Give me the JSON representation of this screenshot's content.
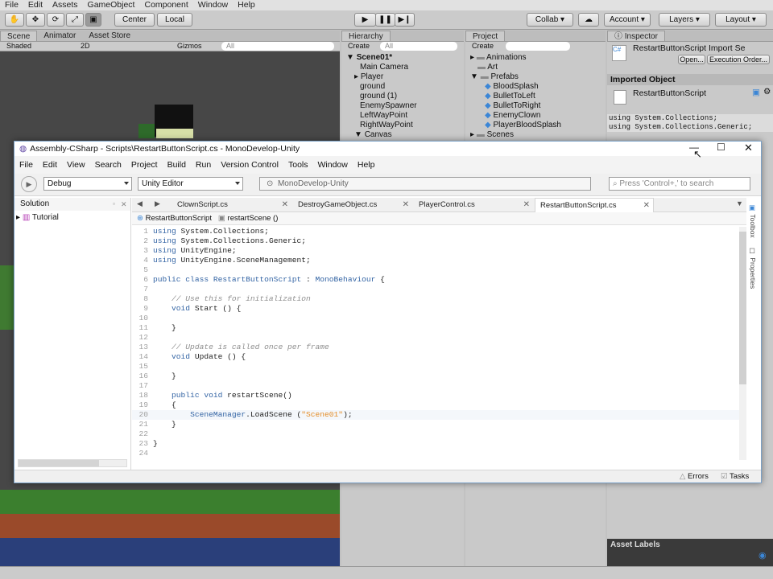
{
  "unity": {
    "menu": [
      "File",
      "Edit",
      "Assets",
      "GameObject",
      "Component",
      "Window",
      "Help"
    ],
    "toolbar": {
      "center": "Center",
      "local": "Local",
      "collab": "Collab",
      "account": "Account",
      "layers": "Layers",
      "layout": "Layout"
    },
    "scene_tabs": [
      "Scene",
      "Animator",
      "Asset Store"
    ],
    "scene_options": {
      "shading": "Shaded",
      "mode": "2D",
      "gizmos": "Gizmos",
      "search": "All"
    },
    "hierarchy": {
      "tab": "Hierarchy",
      "create": "Create",
      "search": "All",
      "scene": "Scene01*",
      "items": [
        "Main Camera",
        "Player",
        "ground",
        "ground (1)",
        "EnemySpawner",
        "LeftWayPoint",
        "RightWayPoint",
        "Canvas"
      ]
    },
    "project": {
      "tab": "Project",
      "create": "Create",
      "folders": [
        "Animations",
        "Art",
        "Prefabs"
      ],
      "prefabs": [
        "BloodSplash",
        "BulletToLeft",
        "BulletToRight",
        "EnemyClown",
        "PlayerBloodSplash"
      ],
      "scenes_folder": "Scenes"
    },
    "inspector": {
      "tab": "Inspector",
      "title": "RestartButtonScript Import Se",
      "open": "Open...",
      "execution_order": "Execution Order...",
      "imported_object": "Imported Object",
      "object_name": "RestartButtonScript",
      "preview_lines": [
        "using System.Collections;",
        "using System.Collections.Generic;"
      ],
      "asset_labels": "Asset Labels"
    }
  },
  "mono": {
    "title": "Assembly-CSharp - Scripts\\RestartButtonScript.cs - MonoDevelop-Unity",
    "menu": [
      "File",
      "Edit",
      "View",
      "Search",
      "Project",
      "Build",
      "Run",
      "Version Control",
      "Tools",
      "Window",
      "Help"
    ],
    "config": "Debug",
    "target": "Unity Editor",
    "status": "MonoDevelop-Unity",
    "search_placeholder": "Press 'Control+,' to search",
    "solution": {
      "title": "Solution",
      "item": "Tutorial"
    },
    "tabs": [
      "ClownScript.cs",
      "DestroyGameObject.cs",
      "PlayerControl.cs",
      "RestartButtonScript.cs"
    ],
    "breadcrumb": {
      "class": "RestartButtonScript",
      "method": "restartScene ()"
    },
    "side_pads": [
      "Toolbox",
      "Properties"
    ],
    "status_bar": {
      "errors": "Errors",
      "tasks": "Tasks"
    },
    "code": [
      [
        {
          "t": "using",
          "c": "kw"
        },
        {
          "t": " System.Collections;",
          "c": "fn"
        }
      ],
      [
        {
          "t": "using",
          "c": "kw"
        },
        {
          "t": " System.Collections.Generic;",
          "c": "fn"
        }
      ],
      [
        {
          "t": "using",
          "c": "kw"
        },
        {
          "t": " UnityEngine;",
          "c": "fn"
        }
      ],
      [
        {
          "t": "using",
          "c": "kw"
        },
        {
          "t": " UnityEngine.SceneManagement;",
          "c": "fn"
        }
      ],
      [],
      [
        {
          "t": "public class ",
          "c": "kw"
        },
        {
          "t": "RestartButtonScript",
          "c": "ty"
        },
        {
          "t": " : ",
          "c": "fn"
        },
        {
          "t": "MonoBehaviour",
          "c": "ty"
        },
        {
          "t": " {",
          "c": "fn"
        }
      ],
      [],
      [
        {
          "t": "    // Use this for initialization",
          "c": "cm"
        }
      ],
      [
        {
          "t": "    ",
          "c": "fn"
        },
        {
          "t": "void",
          "c": "kw"
        },
        {
          "t": " Start () {",
          "c": "fn"
        }
      ],
      [],
      [
        {
          "t": "    }",
          "c": "fn"
        }
      ],
      [],
      [
        {
          "t": "    // Update is called once per frame",
          "c": "cm"
        }
      ],
      [
        {
          "t": "    ",
          "c": "fn"
        },
        {
          "t": "void",
          "c": "kw"
        },
        {
          "t": " Update () {",
          "c": "fn"
        }
      ],
      [],
      [
        {
          "t": "    }",
          "c": "fn"
        }
      ],
      [],
      [
        {
          "t": "    ",
          "c": "fn"
        },
        {
          "t": "public void",
          "c": "kw"
        },
        {
          "t": " restartScene()",
          "c": "fn"
        }
      ],
      [
        {
          "t": "    {",
          "c": "fn"
        }
      ],
      [
        {
          "t": "        ",
          "c": "fn"
        },
        {
          "t": "SceneManager",
          "c": "ty"
        },
        {
          "t": ".LoadScene (",
          "c": "fn"
        },
        {
          "t": "\"Scene01\"",
          "c": "st"
        },
        {
          "t": ");",
          "c": "fn"
        }
      ],
      [
        {
          "t": "    }",
          "c": "fn"
        }
      ],
      [],
      [
        {
          "t": "}",
          "c": "fn"
        }
      ],
      []
    ]
  }
}
